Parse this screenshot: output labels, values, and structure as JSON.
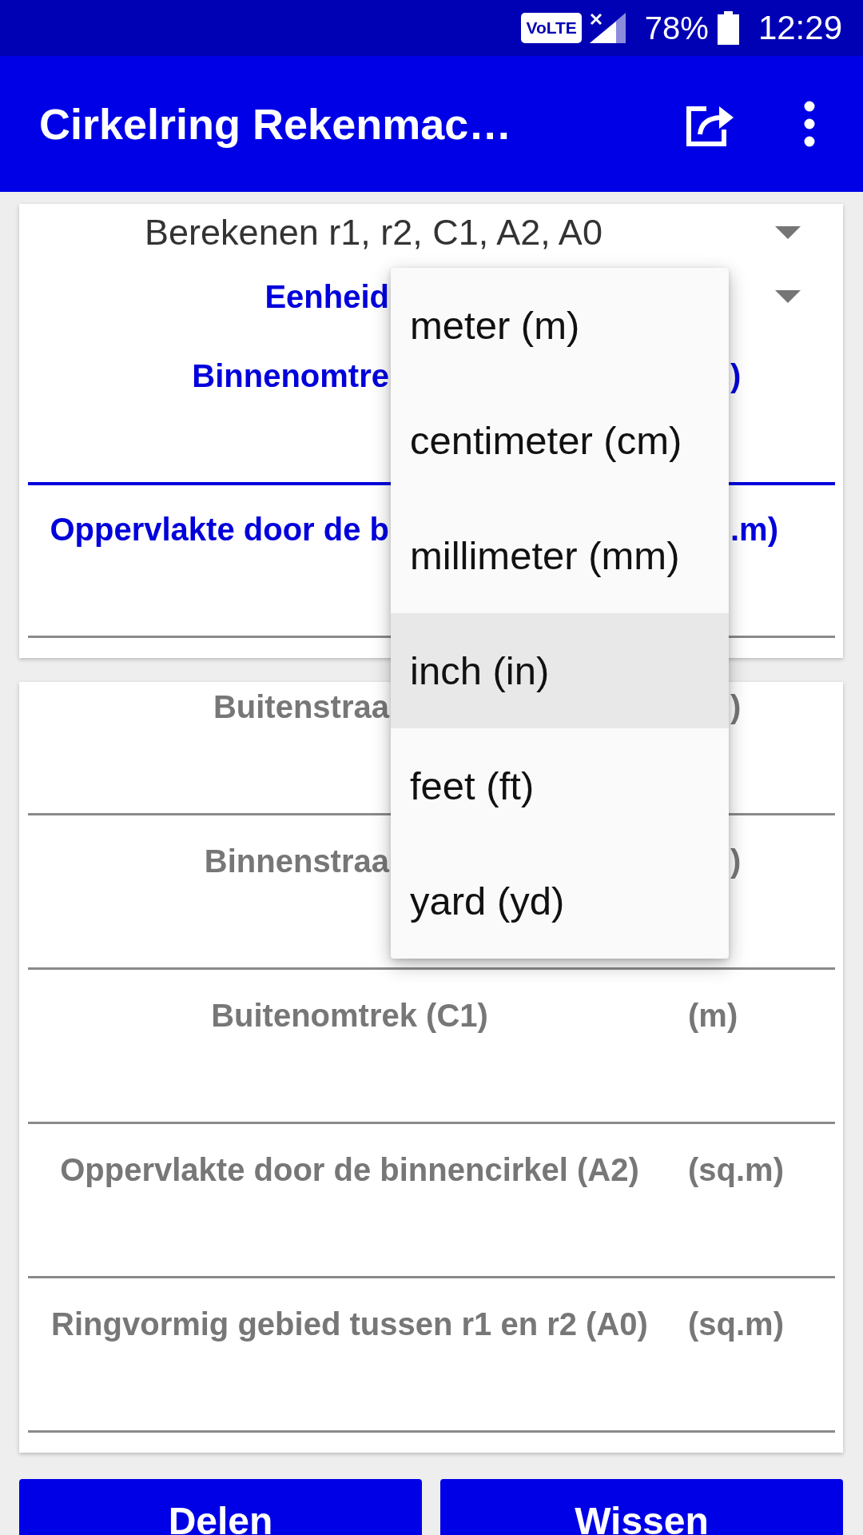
{
  "status_bar": {
    "network_badge": "VoLTE",
    "battery": "78%",
    "time": "12:29"
  },
  "app_bar": {
    "title": "Cirkelring Rekenmac…"
  },
  "input_card": {
    "mode_spinner": {
      "value": "Berekenen r1, r2, C1, A2, A0"
    },
    "unit_spinner": {
      "label": "Eenheid"
    },
    "fields": [
      {
        "label": "Binnenomtre",
        "unit": ")",
        "focused": true
      },
      {
        "label": "Oppervlakte door de b",
        "unit": ".m)",
        "focused": false
      }
    ]
  },
  "results_card": {
    "fields": [
      {
        "label": "Buitenstraa",
        "unit": ")",
        "focused": false
      },
      {
        "label": "Binnenstraa",
        "unit": ")",
        "focused": false
      },
      {
        "label": "Buitenomtrek (C1)",
        "unit": "(m)",
        "focused": false
      },
      {
        "label": "Oppervlakte door de binnencirkel (A2)",
        "unit": "(sq.m)",
        "focused": false
      },
      {
        "label": "Ringvormig gebied tussen r1 en r2 (A0)",
        "unit": "(sq.m)",
        "focused": false
      }
    ]
  },
  "unit_menu": {
    "open": true,
    "items": [
      {
        "label": "meter (m)",
        "selected": false
      },
      {
        "label": "centimeter (cm)",
        "selected": false
      },
      {
        "label": "millimeter (mm)",
        "selected": false
      },
      {
        "label": "inch (in)",
        "selected": true
      },
      {
        "label": "feet (ft)",
        "selected": false
      },
      {
        "label": "yard (yd)",
        "selected": false
      }
    ]
  },
  "buttons": [
    {
      "label": "Delen"
    },
    {
      "label": "Wissen"
    }
  ]
}
